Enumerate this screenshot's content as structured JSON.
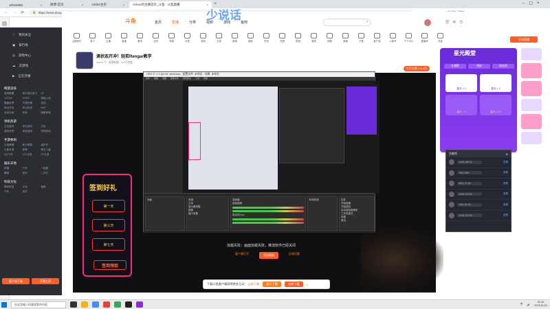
{
  "browser": {
    "tabs": [
      {
        "label": "10034880"
      },
      {
        "label": "微博-首页"
      },
      {
        "label": "Adobe主页"
      },
      {
        "label": "Action的主播首页_斗鱼 · 斗鱼直播"
      }
    ],
    "url": "https://www.douyu.com/10034880",
    "right_status": "11条可能已删除"
  },
  "page_title_overlay": "少说话",
  "sidebar": {
    "top_items": [
      "我的关注",
      "排行榜",
      "游戏中心",
      "云游戏",
      "正在开播"
    ],
    "sections": [
      {
        "title": "网游竞技",
        "items": [
          "英雄联盟",
          "地下城与勇士",
          "CF",
          "DOTA2",
          "CSGO",
          "穿越火线",
          "魔兽世界",
          "守望先锋",
          "逆战",
          "命运方舟",
          "炉石传说",
          "DNF",
          "永劫无间",
          "传奇",
          "魔兽争霸"
        ]
      },
      {
        "title": "单机热游",
        "items": [
          "主机游戏",
          "怀旧游戏",
          "方舟",
          "我的世界",
          "单机游戏",
          "恐怖游戏"
        ]
      },
      {
        "title": "手游休闲",
        "items": [
          "王者荣耀",
          "和平精英",
          "金铲铲",
          "火影手游",
          "原神",
          "第五人格",
          "QQ飞车",
          "LOL手游",
          "CF手游"
        ]
      },
      {
        "title": "娱乐天地",
        "items": [
          "颜值",
          "户外",
          "一起看",
          "舞蹈",
          "音乐",
          "二次元"
        ]
      },
      {
        "title": "科技文化",
        "items": [
          "数码科技",
          "文化",
          "鱼教",
          "汽车",
          "历史"
        ]
      }
    ],
    "btn_download": "客户端下载",
    "btn_open": "开播工具"
  },
  "header": {
    "logo": "斗鱼",
    "nav": [
      "首页",
      "直播",
      "分类",
      "视频",
      "游戏",
      "鱼吧"
    ],
    "search_placeholder": "",
    "icons": [
      "主播排行",
      "新人",
      "主播",
      "直播",
      "鱼吧",
      "活动",
      "商城",
      "分类",
      "游戏",
      "云游",
      "赛事",
      "福利",
      "任务",
      "充值",
      "签到",
      "道具",
      "视频",
      "鱼塘",
      "下载",
      "客户端",
      "斗鱼号",
      "个人中心",
      "直播间",
      "消息",
      "历史",
      "关注"
    ],
    "open_btn": "开始直播"
  },
  "stream": {
    "title": "滴状态开冲！轻若Rengar教学",
    "meta": "Action飞  · 英雄联盟 · 3.5万热度",
    "follow": "关注主播 | 11.3万"
  },
  "obs": {
    "title": "OBS 27.1.3 (64-bit, windows) - 配置文件: 未命名 - 场景: 未命名",
    "menu": [
      "文件",
      "编辑",
      "视图",
      "配置文件",
      "场景集合",
      "工具",
      "帮助"
    ],
    "docks": [
      "场景",
      "来源",
      "混音器",
      "转场特效",
      "控件"
    ],
    "sources": [
      "文本",
      "显示器采集",
      "图像",
      "窗口采集"
    ],
    "controls": [
      "开始直播",
      "开始录制",
      "启动虚拟摄像机",
      "工作室模式",
      "设置",
      "退出"
    ],
    "mixer": [
      "桌面音频",
      "麦克风/Aux"
    ]
  },
  "player": {
    "error_text": "加载失败：画面加载失败，推流软件已经关闭",
    "link1": "客户端打开",
    "btn_retry": "再次刷新",
    "link2": "反馈问题"
  },
  "checkin": {
    "title": "签到好礼",
    "days": [
      "第一天",
      "第三天",
      "第七天"
    ],
    "button": "签到领取"
  },
  "right_panel": {
    "title": "星光殿堂",
    "tabs": [
      "礼物榜",
      "贵族",
      "粉丝团"
    ],
    "cards": [
      "星光 × 1",
      "星光 × 3",
      "星光 × 5",
      "星光 × 10"
    ]
  },
  "rank": {
    "title": "贡献榜",
    "rows": [
      {
        "value": "13/48 | 68.1%",
        "link": "查看"
      },
      {
        "value": "7/45 | 40%",
        "link": "查看"
      },
      {
        "value": "6/48 | 17.5%",
        "link": "查看"
      },
      {
        "value": "10/48 | 51.3%",
        "link": "查看"
      },
      {
        "value": "7/48 | 51.3%",
        "link": "查看"
      },
      {
        "value": "10/48 | 51.3%",
        "link": "查看"
      }
    ]
  },
  "download_bar": {
    "text": "下载斗鱼客户端获得更多互动",
    "link": "立即下载",
    "btn1": "暂不了解",
    "btn2": "立即下载"
  },
  "taskbar": {
    "search": "在这里输入你要搜索的内容",
    "time": "20:16",
    "date": "2021/11/24",
    "lang": "中"
  }
}
